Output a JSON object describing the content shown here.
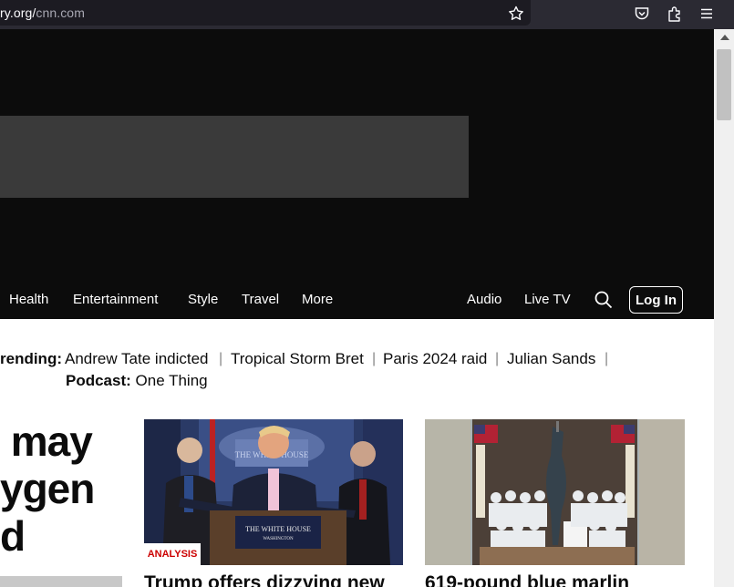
{
  "browser": {
    "url_host": "ry.org/",
    "url_path": "cnn.com"
  },
  "nav": {
    "left": [
      "Health",
      "Entertainment",
      "Style",
      "Travel",
      "More"
    ],
    "right": [
      "Audio",
      "Live TV"
    ],
    "login_label": "Log In"
  },
  "trending": {
    "label": "rending:",
    "items": [
      "Andrew Tate indicted",
      "Tropical Storm Bret",
      "Paris 2024 raid",
      "Julian Sands"
    ],
    "separator": "|",
    "podcast_label": "Podcast:",
    "podcast_value": "One Thing"
  },
  "lead": {
    "headline": " may\nygen\nd"
  },
  "cards": [
    {
      "badge": "ANALYSIS",
      "title": "Trump offers dizzying new",
      "image_text_1": "THE WHITE HOUSE",
      "image_text_2": "WASHINGTON",
      "image_text_3": "THE WHITE HOUSE"
    },
    {
      "title": "619-pound blue marlin"
    }
  ],
  "colors": {
    "accent": "#cc0000",
    "nav_bg": "#0c0c0c",
    "ad_placeholder": "#3a3a3a"
  }
}
